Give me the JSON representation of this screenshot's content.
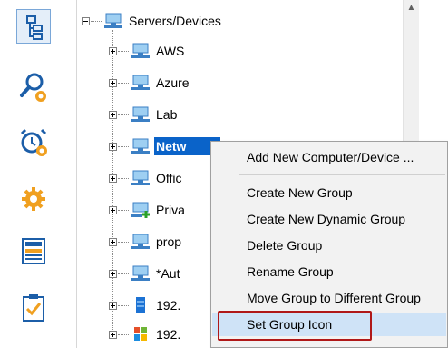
{
  "toolbar": {
    "buttons": [
      {
        "name": "tree-view-icon",
        "selected": true
      },
      {
        "name": "search-settings-icon",
        "selected": false
      },
      {
        "name": "alarm-settings-icon",
        "selected": false
      },
      {
        "name": "settings-icon",
        "selected": false
      },
      {
        "name": "news-icon",
        "selected": false
      },
      {
        "name": "checklist-icon",
        "selected": false
      }
    ]
  },
  "tree": {
    "root": {
      "label": "Servers/Devices",
      "icon": "network-group-icon",
      "expanded": true
    },
    "items": [
      {
        "label": "AWS",
        "icon": "network-group-icon"
      },
      {
        "label": "Azure",
        "icon": "network-group-icon"
      },
      {
        "label": "Lab",
        "icon": "network-group-icon"
      },
      {
        "label": "Netw",
        "icon": "network-group-icon",
        "selected": true
      },
      {
        "label": "Offic",
        "icon": "network-group-icon"
      },
      {
        "label": "Priva",
        "icon": "network-group-add-icon"
      },
      {
        "label": "prop",
        "icon": "network-group-icon"
      },
      {
        "label": "*Aut",
        "icon": "network-group-icon"
      },
      {
        "label": "192.",
        "icon": "server-icon"
      },
      {
        "label": "192.",
        "icon": "windows-icon"
      }
    ],
    "selected_color": "#0a63c9"
  },
  "scrollbar": {
    "up_arrow": "▲"
  },
  "context_menu": {
    "items": [
      {
        "label": "Add New Computer/Device ..."
      },
      {
        "label": "Create New Group"
      },
      {
        "label": "Create New Dynamic Group"
      },
      {
        "label": "Delete Group"
      },
      {
        "label": "Rename Group"
      },
      {
        "label": "Move Group to Different Group"
      },
      {
        "label": "Set Group Icon",
        "highlighted": true
      }
    ],
    "highlight_color": "#cfe3f7",
    "callout_color": "#b01818"
  }
}
